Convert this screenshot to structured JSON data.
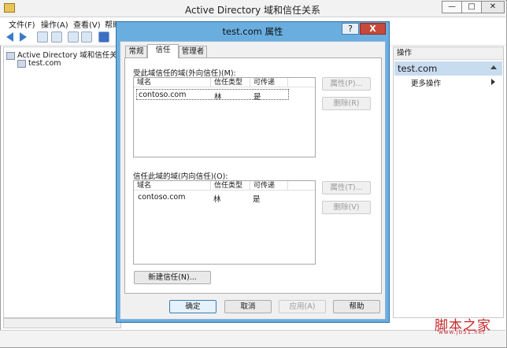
{
  "window": {
    "title": "Active Directory 域和信任关系",
    "min": "—",
    "max": "□",
    "close": "✕"
  },
  "menu": {
    "items": [
      "文件(F)",
      "操作(A)",
      "查看(V)",
      "帮助(H)"
    ]
  },
  "tree": {
    "root": "Active Directory 域和信任关系",
    "child": "test.com"
  },
  "actions": {
    "header": "操作",
    "domain": "test.com",
    "more": "更多操作"
  },
  "dialog": {
    "title": "test.com 属性",
    "help": "?",
    "close": "X",
    "tabs": [
      "常规",
      "信任",
      "管理者"
    ],
    "active_tab": "信任",
    "outgoing": {
      "label": "受此域信任的域(外向信任)(M):",
      "columns": [
        "域名",
        "信任类型",
        "可传递"
      ],
      "rows": [
        [
          "contoso.com",
          "林",
          "是"
        ]
      ],
      "properties_button": "属性(P)...",
      "remove_button": "删除(R)"
    },
    "incoming": {
      "label": "信任此域的域(内向信任)(O):",
      "columns": [
        "域名",
        "信任类型",
        "可传递"
      ],
      "rows": [
        [
          "contoso.com",
          "林",
          "是"
        ]
      ],
      "properties_button": "属性(T)...",
      "remove_button": "删除(V)"
    },
    "new_trust_button": "新建信任(N)...",
    "ok": "确定",
    "cancel": "取消",
    "apply": "应用(A)",
    "help_button": "帮助"
  },
  "watermark": {
    "text": "脚本之家",
    "url": "www.jb51.net"
  }
}
